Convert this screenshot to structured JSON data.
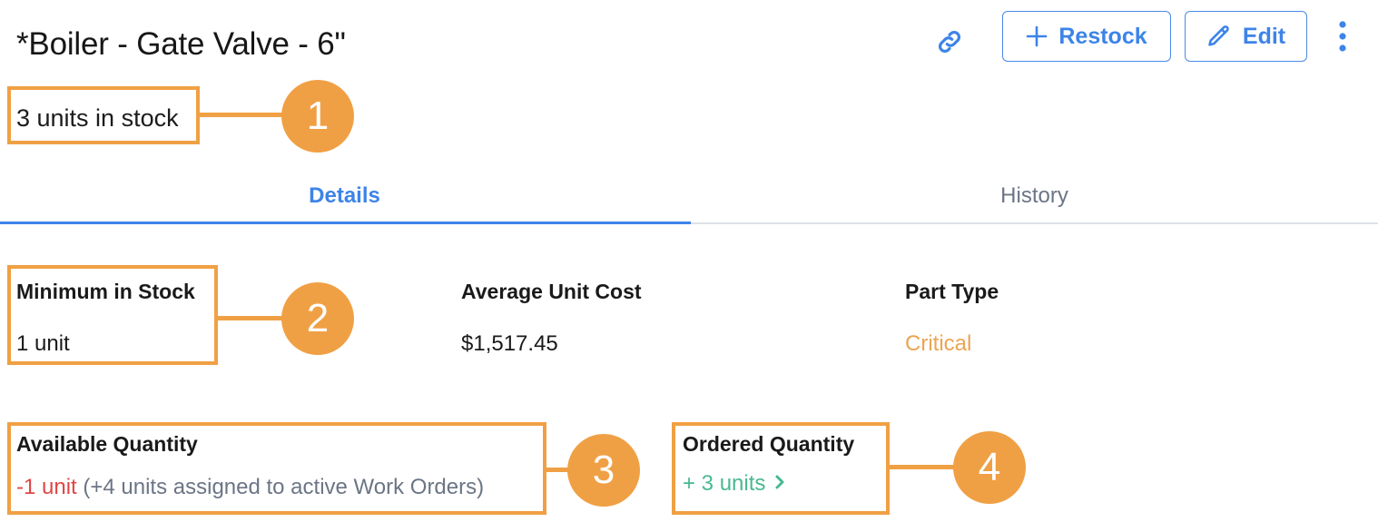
{
  "header": {
    "title": "*Boiler - Gate Valve - 6\"",
    "stock_status": "3 units in stock",
    "actions": {
      "copy_link_icon": "link-icon",
      "restock_label": "Restock",
      "restock_icon": "plus-icon",
      "edit_label": "Edit",
      "edit_icon": "pencil-icon",
      "more_icon": "more-vertical-icon"
    }
  },
  "tabs": [
    {
      "label": "Details",
      "active": true
    },
    {
      "label": "History",
      "active": false
    }
  ],
  "details": {
    "minimum_in_stock": {
      "label": "Minimum in Stock",
      "value": "1 unit"
    },
    "average_unit_cost": {
      "label": "Average Unit Cost",
      "value": "$1,517.45"
    },
    "part_type": {
      "label": "Part Type",
      "value": "Critical"
    },
    "available_quantity": {
      "label": "Available Quantity",
      "value": "-1 unit",
      "note": "(+4 units assigned to active Work Orders)"
    },
    "ordered_quantity": {
      "label": "Ordered Quantity",
      "value": "+ 3 units",
      "icon": "chevron-right-icon"
    }
  },
  "annotations": [
    {
      "number": "1",
      "target": "stock-status"
    },
    {
      "number": "2",
      "target": "minimum-in-stock"
    },
    {
      "number": "3",
      "target": "available-quantity"
    },
    {
      "number": "4",
      "target": "ordered-quantity"
    }
  ],
  "colors": {
    "accent": "#3d84e8",
    "annotation": "#f0a044",
    "critical": "#eba553",
    "negative": "#e04545",
    "positive": "#4ab890",
    "muted": "#6b7585"
  }
}
